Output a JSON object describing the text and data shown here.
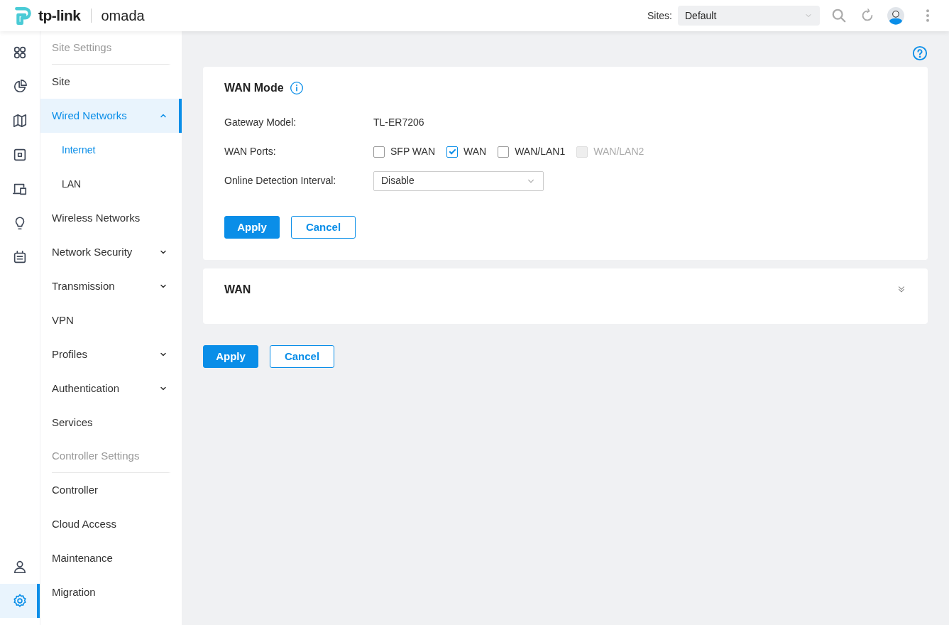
{
  "brand": {
    "logo_text": "tp-link",
    "product": "omada"
  },
  "header": {
    "sites_label": "Sites:",
    "site_select": {
      "value": "Default"
    }
  },
  "rail": {
    "top": [
      {
        "selected": false
      },
      {
        "selected": false
      },
      {
        "selected": false
      },
      {
        "selected": false
      },
      {
        "selected": false
      },
      {
        "selected": false
      },
      {
        "selected": false
      }
    ],
    "bottom": [
      {
        "selected": false
      },
      {
        "selected": true
      }
    ]
  },
  "menu": [
    {
      "kind": "heading",
      "label": "Site Settings"
    },
    {
      "kind": "link",
      "label": "Site",
      "selected": false
    },
    {
      "kind": "group",
      "label": "Wired Networks",
      "selected": true,
      "expanded": true
    },
    {
      "kind": "sublink",
      "label": "Internet",
      "selected": true
    },
    {
      "kind": "sublink",
      "label": "LAN",
      "selected": false
    },
    {
      "kind": "link",
      "label": "Wireless Networks",
      "selected": false
    },
    {
      "kind": "group",
      "label": "Network Security",
      "selected": false,
      "expanded": false
    },
    {
      "kind": "group",
      "label": "Transmission",
      "selected": false,
      "expanded": false
    },
    {
      "kind": "link",
      "label": "VPN",
      "selected": false
    },
    {
      "kind": "group",
      "label": "Profiles",
      "selected": false,
      "expanded": false
    },
    {
      "kind": "group",
      "label": "Authentication",
      "selected": false,
      "expanded": false
    },
    {
      "kind": "link",
      "label": "Services",
      "selected": false
    },
    {
      "kind": "heading",
      "label": "Controller Settings"
    },
    {
      "kind": "link",
      "label": "Controller",
      "selected": false
    },
    {
      "kind": "link",
      "label": "Cloud Access",
      "selected": false
    },
    {
      "kind": "link",
      "label": "Maintenance",
      "selected": false
    },
    {
      "kind": "link",
      "label": "Migration",
      "selected": false
    }
  ],
  "wan_mode": {
    "title": "WAN Mode",
    "gateway_model": {
      "label": "Gateway Model:",
      "value": "TL-ER7206"
    },
    "wan_ports": {
      "label": "WAN Ports:",
      "options": [
        {
          "label": "SFP WAN",
          "checked": false,
          "disabled": false
        },
        {
          "label": "WAN",
          "checked": true,
          "disabled": false
        },
        {
          "label": "WAN/LAN1",
          "checked": false,
          "disabled": false
        },
        {
          "label": "WAN/LAN2",
          "checked": false,
          "disabled": true
        }
      ]
    },
    "online_detection": {
      "label": "Online Detection Interval:",
      "value": "Disable"
    },
    "buttons": [
      "Apply",
      "Cancel"
    ]
  },
  "wan": {
    "title": "WAN",
    "expanded": false
  },
  "footer_buttons": [
    "Apply",
    "Cancel"
  ]
}
